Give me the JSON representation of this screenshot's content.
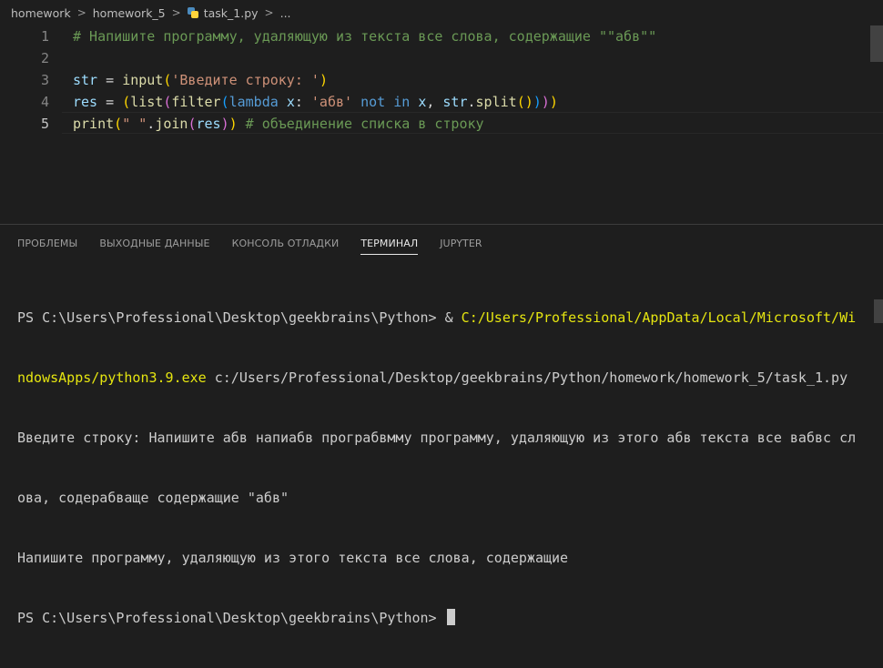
{
  "breadcrumb": {
    "items": [
      "homework",
      "homework_5",
      "task_1.py",
      "..."
    ],
    "separator": ">"
  },
  "editor": {
    "line_numbers": [
      "1",
      "2",
      "3",
      "4",
      "5"
    ],
    "active_line": "5",
    "lines": {
      "l1": {
        "comment": "# Напишите программу, удаляющую из текста все слова, содержащие \"\"абв\"\""
      },
      "l3": {
        "var": "str",
        "eq": " = ",
        "fn": "input",
        "p1": "(",
        "str": "'Введите строку: '",
        "p2": ")"
      },
      "l4": {
        "var": "res",
        "eq": " = ",
        "p1": "(",
        "fn1": "list",
        "p2": "(",
        "fn2": "filter",
        "p3": "(",
        "kw": "lambda",
        "sp1": " ",
        "x1": "x",
        "colon": ": ",
        "str": "'абв'",
        "sp2": " ",
        "notin": "not in",
        "sp3": " ",
        "x2": "x",
        "comma": ", ",
        "obj": "str",
        "dot": ".",
        "fn3": "split",
        "p4": "()",
        "p5": ")",
        "p6": ")",
        "p7": ")"
      },
      "l5": {
        "fn": "print",
        "p1": "(",
        "str": "\" \"",
        "dot": ".",
        "fn2": "join",
        "p2": "(",
        "var": "res",
        "p3": ")",
        "p4": ")",
        "sp": " ",
        "comment": "# объединение списка в строку"
      }
    }
  },
  "panel": {
    "tabs": [
      "ПРОБЛЕМЫ",
      "ВЫХОДНЫЕ ДАННЫЕ",
      "КОНСОЛЬ ОТЛАДКИ",
      "ТЕРМИНАЛ",
      "JUPYTER"
    ],
    "active_tab": "ТЕРМИНАЛ"
  },
  "terminal": {
    "line1_prompt": "PS C:\\Users\\Professional\\Desktop\\geekbrains\\Python> & ",
    "line1_path": "C:/Users/Professional/AppData/Local/Microsoft/Wi",
    "line2_path": "ndowsApps/python3.9.exe",
    "line2_rest": " c:/Users/Professional/Desktop/geekbrains/Python/homework/homework_5/task_1.py",
    "line3": "Введите строку: Напишите абв напиабв програбвмму программу, удаляющую из этого абв текста все вабвс сл",
    "line4": "ова, содерабваще содержащие \"абв\"",
    "line5": "Напишите программу, удаляющую из этого текста все слова, содержащие",
    "line6_prompt": "PS C:\\Users\\Professional\\Desktop\\geekbrains\\Python> "
  },
  "colors": {
    "background": "#1e1e1e",
    "comment": "#6a9955",
    "string": "#ce9178",
    "function": "#dcdcaa",
    "variable": "#9cdcfe",
    "keyword": "#569cd6",
    "control": "#c586c0",
    "terminal_path": "#e5e510"
  }
}
